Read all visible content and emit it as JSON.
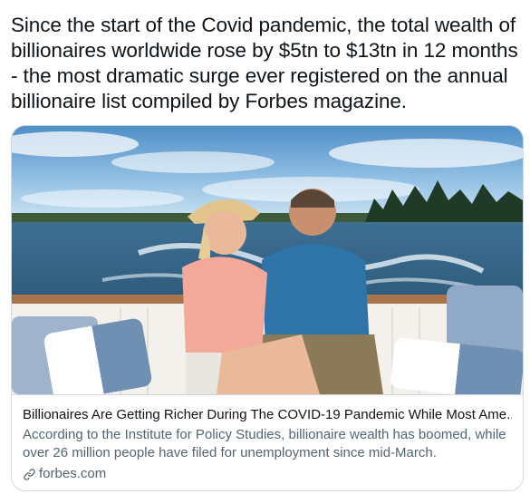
{
  "tweet": {
    "text": "Since the start of the Covid pandemic, the total wealth of billionaires worldwide rose by $5tn to $13tn in 12 months - the most dramatic surge ever registered on the annual billionaire list compiled by Forbes magazine."
  },
  "card": {
    "image_icon": "photo-couple-on-boat",
    "title": "Billionaires Are Getting Richer During The COVID-19 Pandemic While Most Ame...",
    "description": "According to the Institute for Policy Studies, billionaire wealth has boomed, while over 26 million people have filed for unemployment since mid-March.",
    "domain_icon": "link-icon",
    "domain": "forbes.com"
  },
  "colors": {
    "text_primary": "#0f1419",
    "text_secondary": "#536471",
    "border": "#cfd9de"
  }
}
